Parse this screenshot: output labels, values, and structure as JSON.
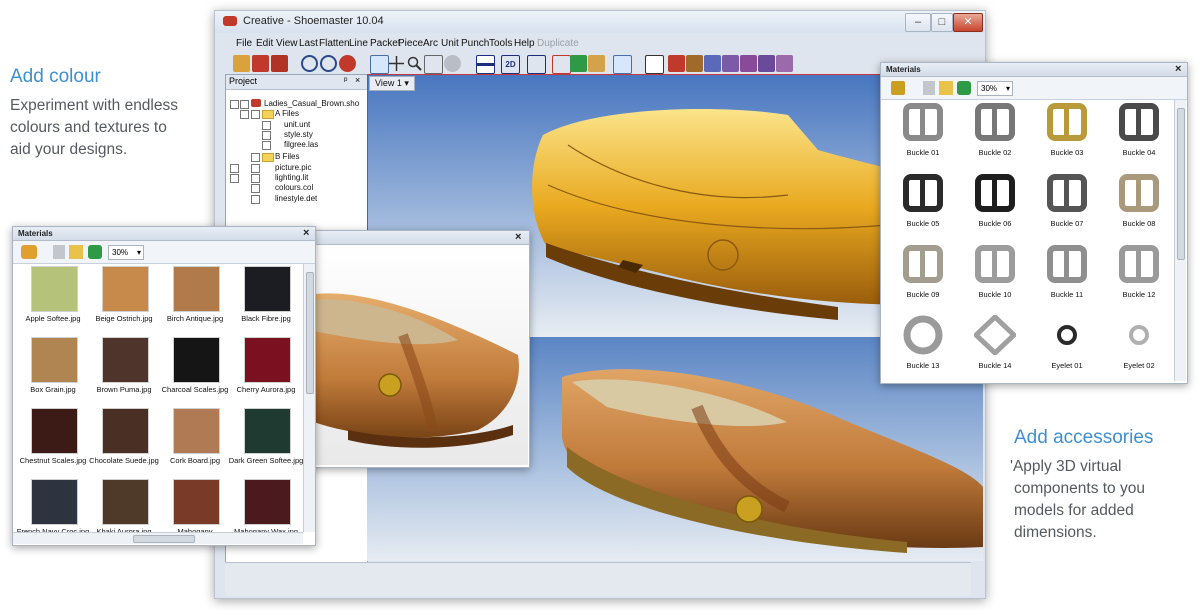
{
  "marketing": {
    "colour_heading": "Add colour",
    "colour_lines": [
      "Experiment with endless",
      "colours and textures to",
      "aid your designs."
    ],
    "accessories_heading": "Add accessories",
    "accessories_lines": [
      "'Apply 3D virtual",
      "components to you",
      "models for added",
      "dimensions."
    ]
  },
  "window": {
    "title": "Creative - Shoemaster 10.04",
    "menu": [
      "File",
      "Edit",
      "View",
      "Last",
      "Flatten",
      "Line",
      "Packet",
      "Piece",
      "Arc",
      "Unit",
      "Punch",
      "Tools",
      "Help",
      "Duplicate"
    ],
    "minimize": "–",
    "maximize": "□",
    "close": "✕"
  },
  "project": {
    "title": "Project",
    "pin": "ᵖ",
    "close": "×",
    "root": "Ladies_Casual_Brown.sho",
    "a_files": "A Files",
    "a_children": [
      "unit.unt",
      "style.sty",
      "filgree.las"
    ],
    "b_files": "B Files",
    "others": [
      "picture.pic",
      "lighting.lit",
      "colours.col",
      "linestyle.det"
    ]
  },
  "viewport": {
    "tab": "View 1"
  },
  "materials_left": {
    "title": "Materials",
    "close": "×",
    "zoom": "30%",
    "items": [
      {
        "label": "Apple Softee.jpg",
        "color": "#b5c27a"
      },
      {
        "label": "Beige Ostrich.jpg",
        "color": "#c88a4a"
      },
      {
        "label": "Birch Antique.jpg",
        "color": "#b07a4a"
      },
      {
        "label": "Black Fibre.jpg",
        "color": "#1b1d22"
      },
      {
        "label": "Box Grain.jpg",
        "color": "#b08552"
      },
      {
        "label": "Brown Puma.jpg",
        "color": "#4f342c"
      },
      {
        "label": "Charcoal Scales.jpg",
        "color": "#151515"
      },
      {
        "label": "Cherry Aurora.jpg",
        "color": "#7a1020"
      },
      {
        "label": "Chestnut Scales.jpg",
        "color": "#3c1a16"
      },
      {
        "label": "Chocolate Suede.jpg",
        "color": "#4a3024"
      },
      {
        "label": "Cork Board.jpg",
        "color": "#b07a55"
      },
      {
        "label": "Dark Green Softee.jpg",
        "color": "#1f3a30"
      },
      {
        "label": "French Navy Croc.jpg",
        "color": "#2e3340"
      },
      {
        "label": "Khaki Aurora.jpg",
        "color": "#4f3a2a"
      },
      {
        "label": "Mahogany",
        "color": "#7a3a28"
      },
      {
        "label": "Mahogany Wax.jpg",
        "color": "#4a1a1e"
      }
    ]
  },
  "preview": {
    "close": "×"
  },
  "materials_right": {
    "title": "Materials",
    "close": "×",
    "zoom": "30%",
    "items": [
      {
        "label": "Buckle 01",
        "kind": "rect",
        "color": "#8a8a8a"
      },
      {
        "label": "Buckle 02",
        "kind": "rect",
        "color": "#777777"
      },
      {
        "label": "Buckle 03",
        "kind": "rect",
        "color": "#b99a3a"
      },
      {
        "label": "Buckle 04",
        "kind": "rect",
        "color": "#4a4a4a"
      },
      {
        "label": "Buckle 05",
        "kind": "rect",
        "color": "#2b2b2b"
      },
      {
        "label": "Buckle 06",
        "kind": "rect",
        "color": "#1e1e1e"
      },
      {
        "label": "Buckle 07",
        "kind": "rect",
        "color": "#555555"
      },
      {
        "label": "Buckle 08",
        "kind": "rect",
        "color": "#a89a7a"
      },
      {
        "label": "Buckle 09",
        "kind": "rect",
        "color": "#a39d8f"
      },
      {
        "label": "Buckle 10",
        "kind": "rect",
        "color": "#9c9c9c"
      },
      {
        "label": "Buckle 11",
        "kind": "rect",
        "color": "#8f8f8f"
      },
      {
        "label": "Buckle 12",
        "kind": "rect",
        "color": "#9a9a9a"
      },
      {
        "label": "Buckle 13",
        "kind": "circle",
        "color": "#9a9a9a"
      },
      {
        "label": "Buckle 14",
        "kind": "diamond",
        "color": "#a0a0a0"
      },
      {
        "label": "Eyelet 01",
        "kind": "eyelet",
        "color": "#2a2a2a"
      },
      {
        "label": "Eyelet 02",
        "kind": "eyelet",
        "color": "#b0b0b0"
      }
    ]
  }
}
